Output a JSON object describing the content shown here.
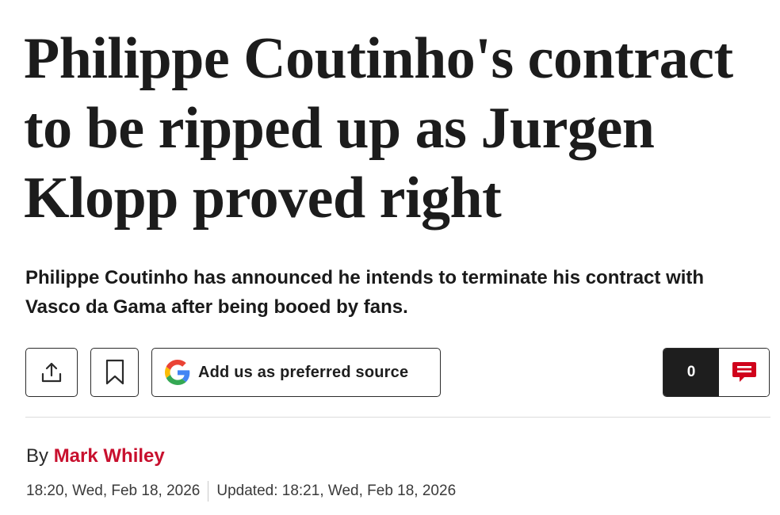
{
  "article": {
    "headline": "Philippe Coutinho's contract to be ripped up as Jurgen Klopp proved right",
    "standfirst": "Philippe Coutinho has announced he intends to terminate his contract with Vasco da Gama after being booed by fans."
  },
  "toolbar": {
    "share_icon": "share-upload-icon",
    "bookmark_icon": "bookmark-icon",
    "google_icon": "google-g-icon",
    "google_label": "Add us as preferred source",
    "comment_count": "0",
    "comment_icon": "speech-bubble-icon"
  },
  "byline": {
    "prefix": "By",
    "author": "Mark Whiley",
    "published": "18:20, Wed, Feb 18, 2026",
    "updated": "Updated: 18:21, Wed, Feb 18, 2026"
  },
  "colors": {
    "author_red": "#c8102e",
    "comment_icon_red": "#d0021b",
    "comment_count_bg": "#1e1e1e",
    "google_blue": "#4285F4",
    "google_red": "#EA4335",
    "google_yellow": "#FBBC05",
    "google_green": "#34A853"
  }
}
